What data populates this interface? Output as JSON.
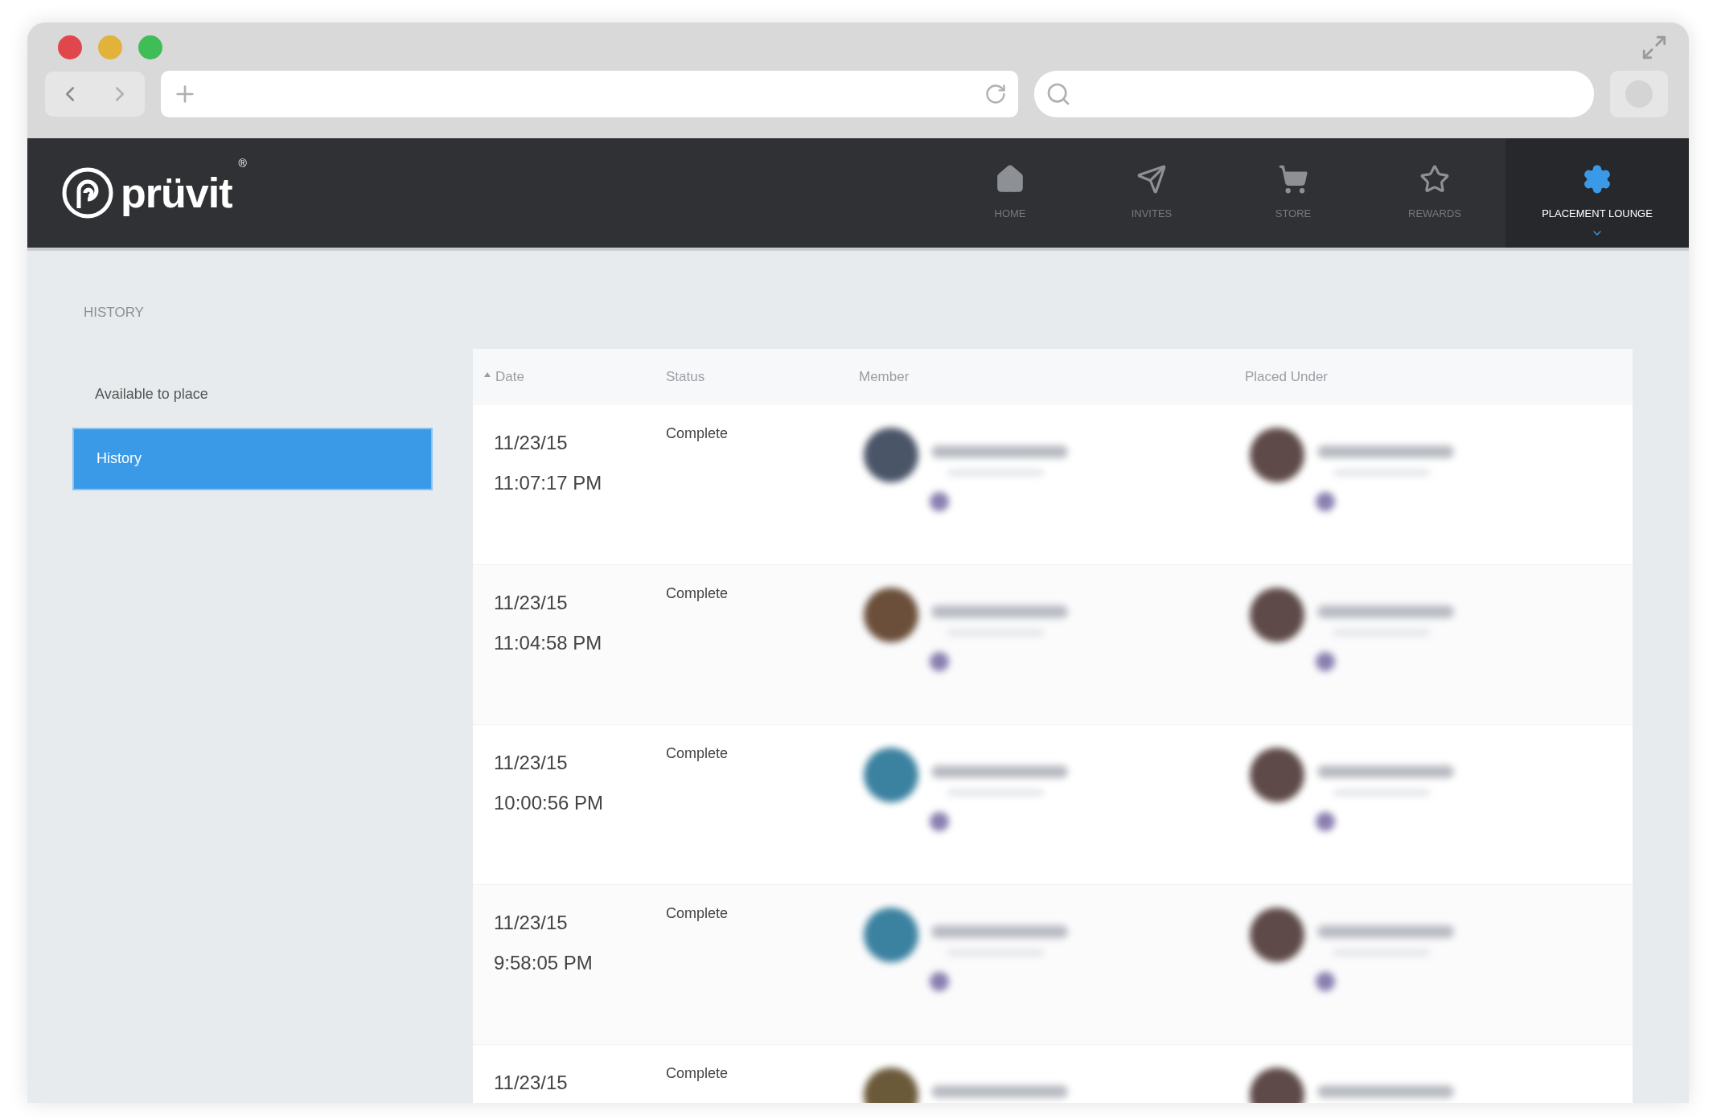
{
  "app": {
    "logo_text": "prüvit",
    "logo_mark": "®"
  },
  "nav": [
    {
      "label": "HOME",
      "selected": false
    },
    {
      "label": "INVITES",
      "selected": false
    },
    {
      "label": "STORE",
      "selected": false
    },
    {
      "label": "REWARDS",
      "selected": false
    },
    {
      "label": "PLACEMENT LOUNGE",
      "selected": true
    }
  ],
  "sidebar": {
    "heading": "HISTORY",
    "items": [
      {
        "label": "Available to place",
        "selected": false
      },
      {
        "label": "History",
        "selected": true
      }
    ]
  },
  "table": {
    "columns": [
      {
        "label": "Date",
        "sorted": true
      },
      {
        "label": "Status",
        "sorted": false
      },
      {
        "label": "Member",
        "sorted": false
      },
      {
        "label": "Placed Under",
        "sorted": false
      }
    ],
    "rows": [
      {
        "date": "11/23/15",
        "time": "11:07:17 PM",
        "status": "Complete"
      },
      {
        "date": "11/23/15",
        "time": "11:04:58 PM",
        "status": "Complete"
      },
      {
        "date": "11/23/15",
        "time": "10:00:56 PM",
        "status": "Complete"
      },
      {
        "date": "11/23/15",
        "time": "9:58:05 PM",
        "status": "Complete"
      },
      {
        "date": "11/23/15",
        "status": "Complete"
      }
    ]
  }
}
